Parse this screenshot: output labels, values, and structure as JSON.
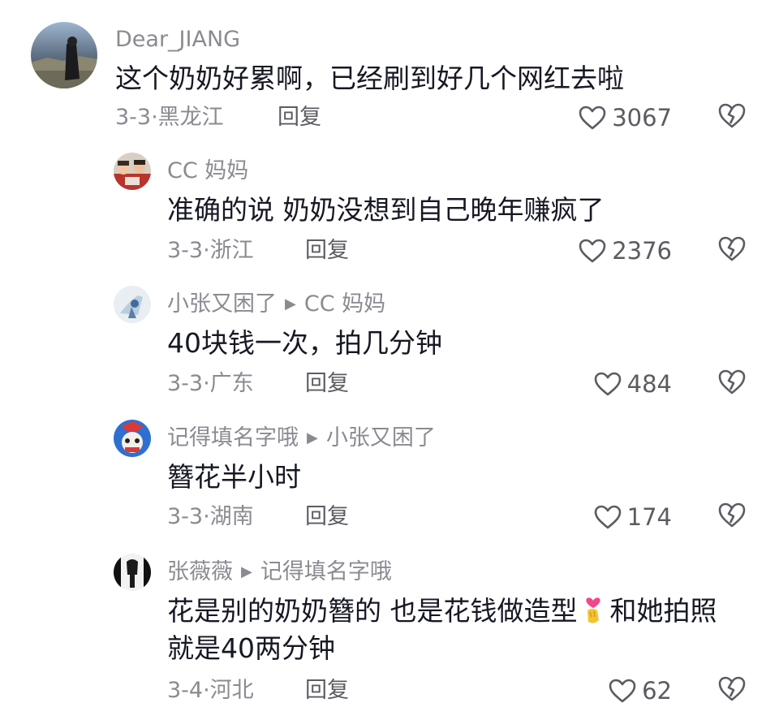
{
  "comments": [
    {
      "user": "Dear_JIANG",
      "reply_to": "",
      "text": "这个奶奶好累啊，已经刷到好几个网红去啦",
      "date": "3-3·黑龙江",
      "reply_label": "回复",
      "likes": "3067",
      "avatar_icon": "avatar-dark-figure",
      "level": 0
    },
    {
      "user": "CC 妈妈",
      "reply_to": "",
      "text": "准确的说 奶奶没想到自己晚年赚疯了",
      "date": "3-3·浙江",
      "reply_label": "回复",
      "likes": "2376",
      "avatar_icon": "avatar-group-photo",
      "level": 1
    },
    {
      "user": "小张又困了",
      "reply_to": "CC 妈妈",
      "text": "40块钱一次，拍几分钟",
      "date": "3-3·广东",
      "reply_label": "回复",
      "likes": "484",
      "avatar_icon": "avatar-light-blue",
      "level": 1
    },
    {
      "user": "记得填名字哦",
      "reply_to": "小张又困了",
      "text": "簪花半小时",
      "date": "3-3·湖南",
      "reply_label": "回复",
      "likes": "174",
      "avatar_icon": "avatar-cartoon",
      "level": 1
    },
    {
      "user": "张薇薇",
      "reply_to": "记得填名字哦",
      "text_part1": "花是别的奶奶簪的 也是花钱做造型",
      "text_part2": "和她拍照就是40两分钟",
      "emoji": "heart-hands-emoji",
      "date": "3-4·河北",
      "reply_label": "回复",
      "likes": "62",
      "avatar_icon": "avatar-black-white",
      "level": 1
    }
  ],
  "colors": {
    "text": "#161823",
    "meta": "#8a8b91",
    "icon": "#5b5c62",
    "background": "#ffffff"
  }
}
